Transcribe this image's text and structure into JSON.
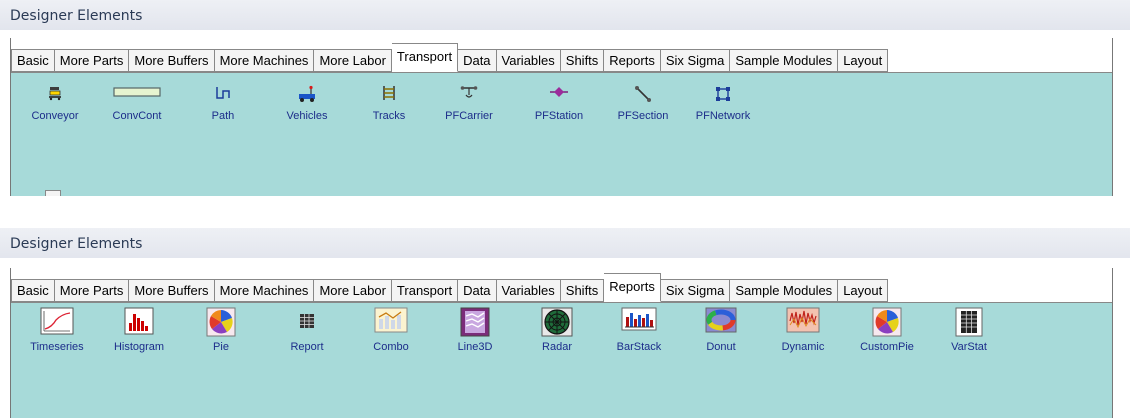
{
  "colors": {
    "content_bg": "#a7dad9",
    "label_text": "#1c2d8a",
    "header_text": "#2a3a55"
  },
  "panel1": {
    "header": {
      "title": "Designer Elements"
    },
    "tabs": [
      "Basic",
      "More Parts",
      "More Buffers",
      "More Machines",
      "More Labor",
      "Transport",
      "Data",
      "Variables",
      "Shifts",
      "Reports",
      "Six Sigma",
      "Sample Modules",
      "Layout"
    ],
    "active_tab": "Transport",
    "elements": [
      {
        "label": "Conveyor",
        "icon": "conveyor-icon"
      },
      {
        "label": "ConvCont",
        "icon": "conveyor-container-icon"
      },
      {
        "label": "Path",
        "icon": "path-icon"
      },
      {
        "label": "Vehicles",
        "icon": "vehicle-icon"
      },
      {
        "label": "Tracks",
        "icon": "tracks-icon"
      },
      {
        "label": "PFCarrier",
        "icon": "pf-carrier-icon"
      },
      {
        "label": "PFStation",
        "icon": "pf-station-icon"
      },
      {
        "label": "PFSection",
        "icon": "pf-section-icon"
      },
      {
        "label": "PFNetwork",
        "icon": "pf-network-icon"
      }
    ]
  },
  "panel2": {
    "header": {
      "title": "Designer Elements"
    },
    "tabs": [
      "Basic",
      "More Parts",
      "More Buffers",
      "More Machines",
      "More Labor",
      "Transport",
      "Data",
      "Variables",
      "Shifts",
      "Reports",
      "Six Sigma",
      "Sample Modules",
      "Layout"
    ],
    "active_tab": "Reports",
    "elements": [
      {
        "label": "Timeseries",
        "icon": "timeseries-chart-icon"
      },
      {
        "label": "Histogram",
        "icon": "histogram-chart-icon"
      },
      {
        "label": "Pie",
        "icon": "pie-chart-icon"
      },
      {
        "label": "Report",
        "icon": "report-table-icon"
      },
      {
        "label": "Combo",
        "icon": "combo-chart-icon"
      },
      {
        "label": "Line3D",
        "icon": "line3d-chart-icon"
      },
      {
        "label": "Radar",
        "icon": "radar-chart-icon"
      },
      {
        "label": "BarStack",
        "icon": "barstack-chart-icon"
      },
      {
        "label": "Donut",
        "icon": "donut-chart-icon"
      },
      {
        "label": "Dynamic",
        "icon": "dynamic-chart-icon"
      },
      {
        "label": "CustomPie",
        "icon": "custom-pie-chart-icon"
      },
      {
        "label": "VarStat",
        "icon": "varstat-icon"
      }
    ]
  }
}
